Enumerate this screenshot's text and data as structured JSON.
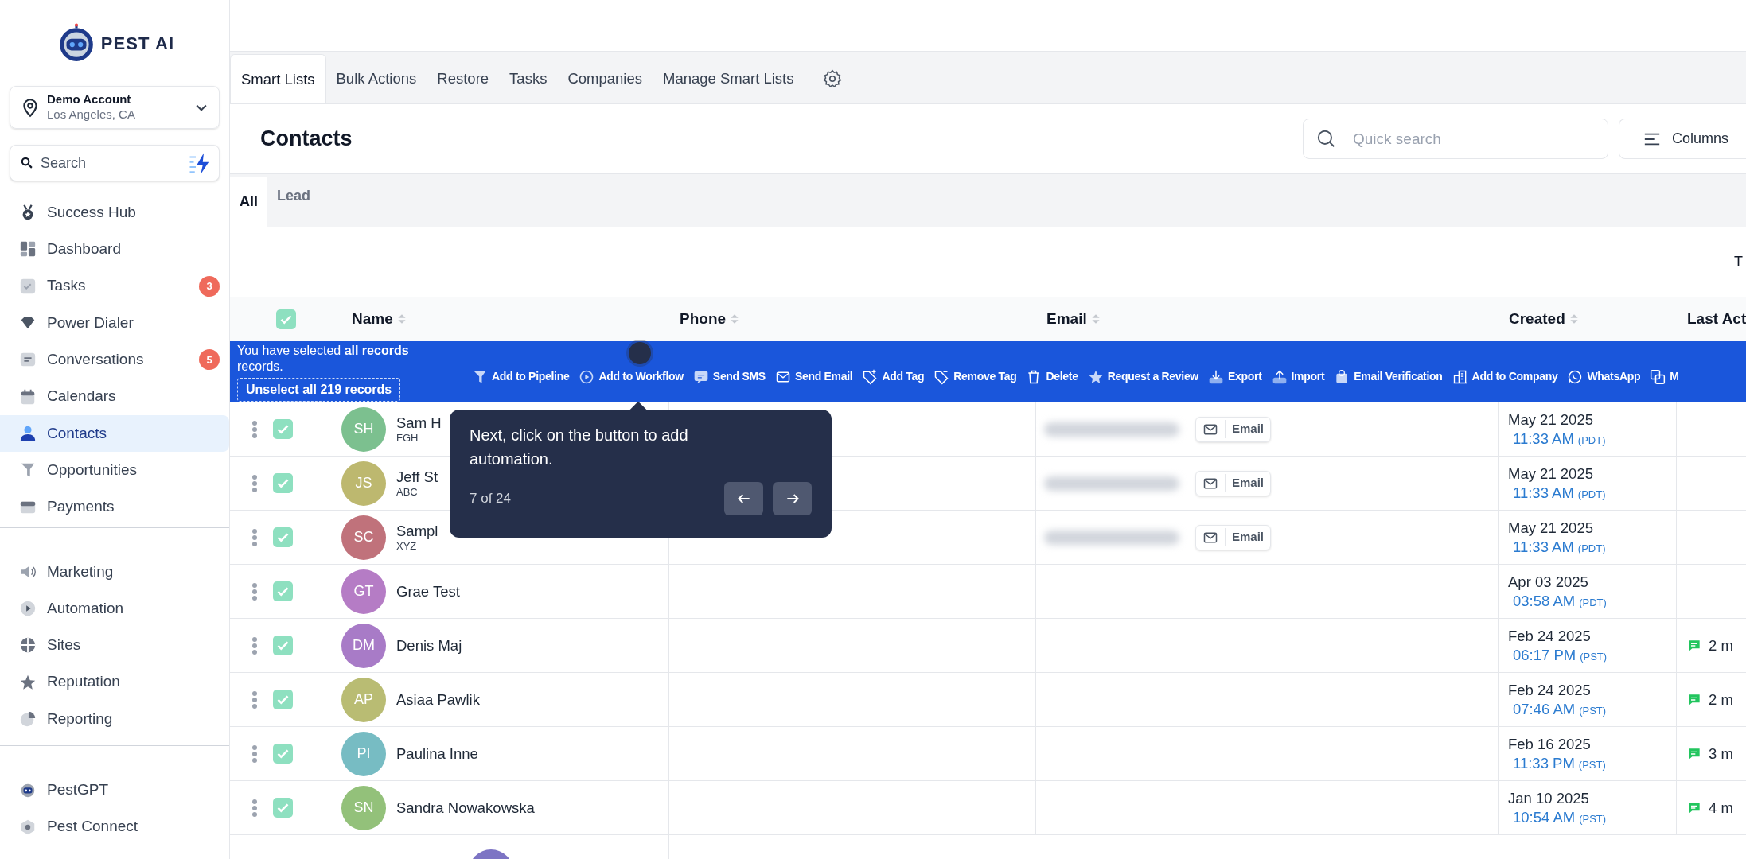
{
  "sidebar": {
    "logo": "PEST AI",
    "account": {
      "name": "Demo Account",
      "location": "Los Angeles, CA"
    },
    "search": {
      "placeholder": "Search"
    },
    "groups": [
      {
        "items": [
          {
            "label": "Success Hub",
            "selected": false
          },
          {
            "label": "Dashboard",
            "selected": false
          },
          {
            "label": "Tasks",
            "selected": false,
            "badge": "3"
          },
          {
            "label": "Power Dialer",
            "selected": false
          },
          {
            "label": "Conversations",
            "selected": false,
            "badge": "5"
          },
          {
            "label": "Calendars",
            "selected": false
          },
          {
            "label": "Contacts",
            "selected": true
          },
          {
            "label": "Opportunities",
            "selected": false
          },
          {
            "label": "Payments",
            "selected": false
          }
        ]
      },
      {
        "items": [
          {
            "label": "Marketing",
            "selected": false
          },
          {
            "label": "Automation",
            "selected": false
          },
          {
            "label": "Sites",
            "selected": false
          },
          {
            "label": "Reputation",
            "selected": false
          },
          {
            "label": "Reporting",
            "selected": false
          }
        ]
      },
      {
        "items": [
          {
            "label": "PestGPT",
            "selected": false
          },
          {
            "label": "Pest Connect",
            "selected": false
          }
        ]
      }
    ]
  },
  "tabs": [
    {
      "label": "Smart Lists",
      "selected": true
    },
    {
      "label": "Bulk Actions",
      "selected": false
    },
    {
      "label": "Restore",
      "selected": false
    },
    {
      "label": "Tasks",
      "selected": false
    },
    {
      "label": "Companies",
      "selected": false
    },
    {
      "label": "Manage Smart Lists",
      "selected": false
    }
  ],
  "page_title": "Contacts",
  "quick_search": {
    "placeholder": "Quick search"
  },
  "columns_button": "Columns",
  "list_tabs": [
    {
      "label": "All",
      "selected": true
    },
    {
      "label": "Lead",
      "selected": false
    }
  ],
  "toolbar_cut_text": "T",
  "table": {
    "header_checked": true,
    "columns": [
      "Name",
      "Phone",
      "Email",
      "Created",
      "Last Act"
    ],
    "selection_bar": {
      "message": "You have selected **all records** records.",
      "unselect": "Unselect all 219 records",
      "actions": [
        "Add to Pipeline",
        "Add to Workflow",
        "Send SMS",
        "Send Email",
        "Add Tag",
        "Remove Tag",
        "Delete",
        "Request a Review",
        "Export",
        "Import",
        "Email Verification",
        "Add to Company",
        "WhatsApp",
        "M"
      ]
    },
    "rows": [
      {
        "initials": "SH",
        "name": "Sam H",
        "company": "FGH",
        "color": "#7cc08f",
        "checked": true,
        "email_button": "Email",
        "date": "May 21 2025",
        "time": "11:33 AM",
        "tz": "(PDT)"
      },
      {
        "initials": "JS",
        "name": "Jeff St",
        "company": "ABC",
        "color": "#bdb86f",
        "checked": true,
        "email_button": "Email",
        "date": "May 21 2025",
        "time": "11:33 AM",
        "tz": "(PDT)"
      },
      {
        "initials": "SC",
        "name": "Sampl",
        "company": "XYZ",
        "color": "#c0727b",
        "checked": true,
        "email_button": "Email",
        "date": "May 21 2025",
        "time": "11:33 AM",
        "tz": "(PDT)"
      },
      {
        "initials": "GT",
        "name": "Grae Test",
        "color": "#b57cc5",
        "checked": true,
        "date": "Apr 03 2025",
        "time": "03:58 AM",
        "tz": "(PDT)"
      },
      {
        "initials": "DM",
        "name": "Denis Maj",
        "color": "#a87bc7",
        "checked": true,
        "date": "Feb 24 2025",
        "time": "06:17 PM",
        "tz": "(PST)",
        "activity": "2 m"
      },
      {
        "initials": "AP",
        "name": "Asiaa Pawlik",
        "color": "#b9bc73",
        "checked": true,
        "date": "Feb 24 2025",
        "time": "07:46 AM",
        "tz": "(PST)",
        "activity": "2 m"
      },
      {
        "initials": "PI",
        "name": "Paulina Inne",
        "color": "#77bcc3",
        "checked": true,
        "date": "Feb 16 2025",
        "time": "11:33 PM",
        "tz": "(PST)",
        "activity": "3 m"
      },
      {
        "initials": "SN",
        "name": "Sandra Nowakowska",
        "color": "#93c17a",
        "checked": true,
        "date": "Jan 10 2025",
        "time": "10:54 AM",
        "tz": "(PST)",
        "activity": "4 m"
      }
    ]
  },
  "tour": {
    "text": "Next, click on the button to add automation.",
    "step": "7 of 24"
  }
}
